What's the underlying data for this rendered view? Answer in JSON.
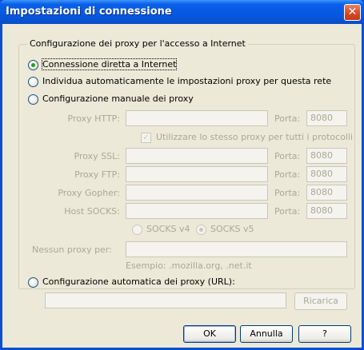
{
  "window": {
    "title": "Impostazioni di connessione",
    "close_glyph": "✕"
  },
  "group": {
    "legend": "Configurazione dei proxy per l'accesso a Internet"
  },
  "options": {
    "direct": "Connessione diretta a Internet",
    "auto_detect": "Individua automaticamente le impostazioni proxy per questa rete",
    "manual": "Configurazione manuale dei proxy",
    "auto_url": "Configurazione automatica dei proxy (URL):"
  },
  "proxies": {
    "http_label": "Proxy HTTP:",
    "same_proxy_label": "Utilizzare lo stesso proxy per tutti i protocolli",
    "ssl_label": "Proxy SSL:",
    "ftp_label": "Proxy FTP:",
    "gopher_label": "Proxy Gopher:",
    "socks_label": "Host SOCKS:",
    "port_label": "Porta:",
    "http_port": "8080",
    "ssl_port": "8080",
    "ftp_port": "8080",
    "gopher_port": "8080",
    "socks_port": "8080",
    "socks_v4": "SOCKS v4",
    "socks_v5": "SOCKS v5",
    "no_proxy_label": "Nessun proxy per:",
    "example": "Esempio: .mozilla.org, .net.it"
  },
  "buttons": {
    "reload": "Ricarica",
    "ok": "OK",
    "cancel": "Annulla",
    "help": "?"
  },
  "colors": {
    "title_bar": "#0658e0",
    "client_bg": "#ece9d8",
    "close_button": "#d94a24",
    "selected_radio": "#21a121"
  }
}
